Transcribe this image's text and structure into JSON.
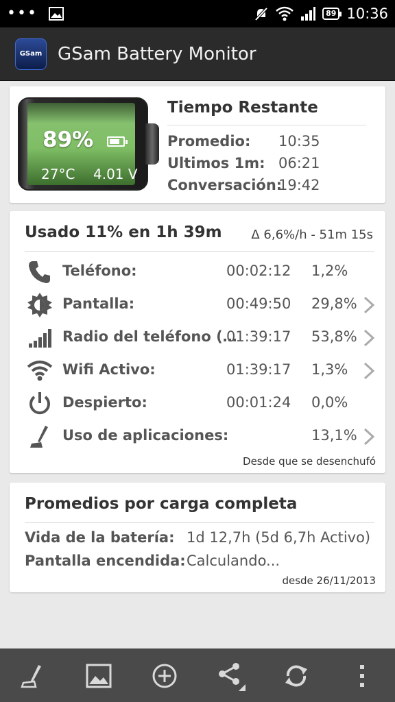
{
  "status_bar": {
    "time": "10:36",
    "battery_level": "89",
    "icons": [
      "more-dots-icon",
      "image-notification-icon",
      "muted-notifications-icon",
      "wifi-icon",
      "signal-icon",
      "battery-icon"
    ]
  },
  "action_bar": {
    "title": "GSam Battery Monitor",
    "icon_label": "GSam"
  },
  "battery_card": {
    "percent": "89%",
    "temperature": "27°C",
    "voltage": "4.01 V",
    "fill_level": 0.89,
    "title": "Tiempo Restante",
    "rows": [
      {
        "label": "Promedio:",
        "value": "10:35"
      },
      {
        "label": "Ultimos 1m:",
        "value": "06:21"
      },
      {
        "label": "Conversación:",
        "value": "19:42"
      }
    ]
  },
  "usage_card": {
    "title": "Usado 11% en 1h 39m",
    "rate": "Δ 6,6%/h - 51m 15s",
    "rows": [
      {
        "icon": "phone-icon",
        "label": "Teléfono:",
        "time": "00:02:12",
        "pct": "1,2%",
        "chevron": false
      },
      {
        "icon": "screen-brightness-icon",
        "label": "Pantalla:",
        "time": "00:49:50",
        "pct": "29,8%",
        "chevron": true
      },
      {
        "icon": "cell-signal-icon",
        "label": "Radio del teléfono (…",
        "time": "01:39:17",
        "pct": "53,8%",
        "chevron": true
      },
      {
        "icon": "wifi-icon",
        "label": "Wifi Activo:",
        "time": "01:39:17",
        "pct": "1,3%",
        "chevron": true
      },
      {
        "icon": "power-icon",
        "label": "Despierto:",
        "time": "00:01:24",
        "pct": "0,0%",
        "chevron": false
      },
      {
        "icon": "app-usage-icon",
        "label": "Uso de aplicaciones:",
        "time": "",
        "pct": "13,1%",
        "chevron": true
      }
    ],
    "since": "Desde que se desenchufó"
  },
  "averages_card": {
    "title": "Promedios por carga completa",
    "rows": [
      {
        "label": "Vida de la batería:",
        "value": "1d 12,7h (5d 6,7h Activo)"
      },
      {
        "label": "Pantalla encendida:",
        "value": "Calculando..."
      }
    ],
    "since": "desde 26/11/2013"
  },
  "bottom_bar": {
    "buttons": [
      "app-usage-icon",
      "image-icon",
      "add-icon",
      "share-icon",
      "refresh-icon",
      "overflow-menu-icon"
    ]
  }
}
